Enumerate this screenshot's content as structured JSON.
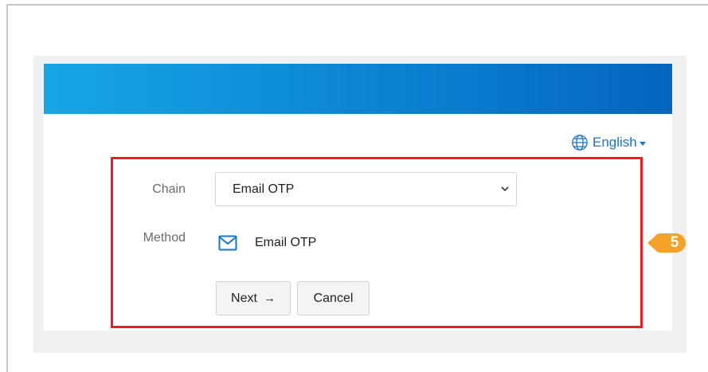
{
  "language": {
    "label": "English",
    "icon": "globe-icon"
  },
  "form": {
    "chain_label": "Chain",
    "chain_value": "Email OTP",
    "method_label": "Method",
    "method_value": "Email OTP",
    "method_icon": "envelope-icon",
    "next_label": "Next",
    "next_icon": "arrow-right-icon",
    "cancel_label": "Cancel"
  },
  "annotation": {
    "step_number": "5",
    "highlight_color": "#ee1c24",
    "badge_color": "#f4a22b"
  },
  "colors": {
    "banner_start": "#17a6e6",
    "banner_end": "#0466bf",
    "link": "#1a73c8"
  }
}
